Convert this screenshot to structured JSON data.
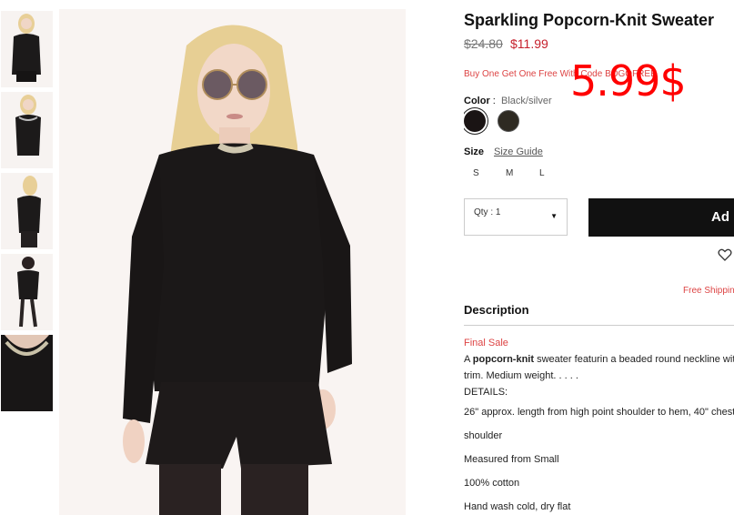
{
  "product": {
    "title": "Sparkling Popcorn-Knit Sweater",
    "old_price": "$24.80",
    "new_price": "$11.99",
    "promo": "Buy One Get One Free With Code BOGOFREE",
    "overlay_price": "5.99$"
  },
  "color": {
    "label": "Color",
    "separator": ":",
    "value": "Black/silver",
    "swatches": [
      {
        "name": "Black/silver",
        "hex": "#1a1414"
      },
      {
        "name": "Dark olive",
        "hex": "#2e2a22"
      }
    ]
  },
  "size": {
    "label": "Size",
    "guide": "Size Guide",
    "options": [
      "S",
      "M",
      "L"
    ]
  },
  "qty": {
    "label": "Qty : 1"
  },
  "add_button": {
    "label": "Ad"
  },
  "shipping": {
    "label": "Free Shippin"
  },
  "description": {
    "heading": "Description",
    "final_sale": "Final Sale",
    "intro_prefix": "A ",
    "intro_bold": "popcorn-knit",
    "intro_rest": " sweater featurin a beaded round neckline wit",
    "intro_line2": "trim. Medium weight. . . . .",
    "details_label": "DETAILS:",
    "details": [
      "26\" approx. length from high point shoulder to hem, 40\" chest,",
      "shoulder",
      "Measured from Small",
      "100% cotton",
      "Hand wash cold, dry flat"
    ]
  },
  "colors": {
    "accent_red": "#c6202c",
    "button_black": "#111111",
    "overlay_red": "#ff0000"
  }
}
